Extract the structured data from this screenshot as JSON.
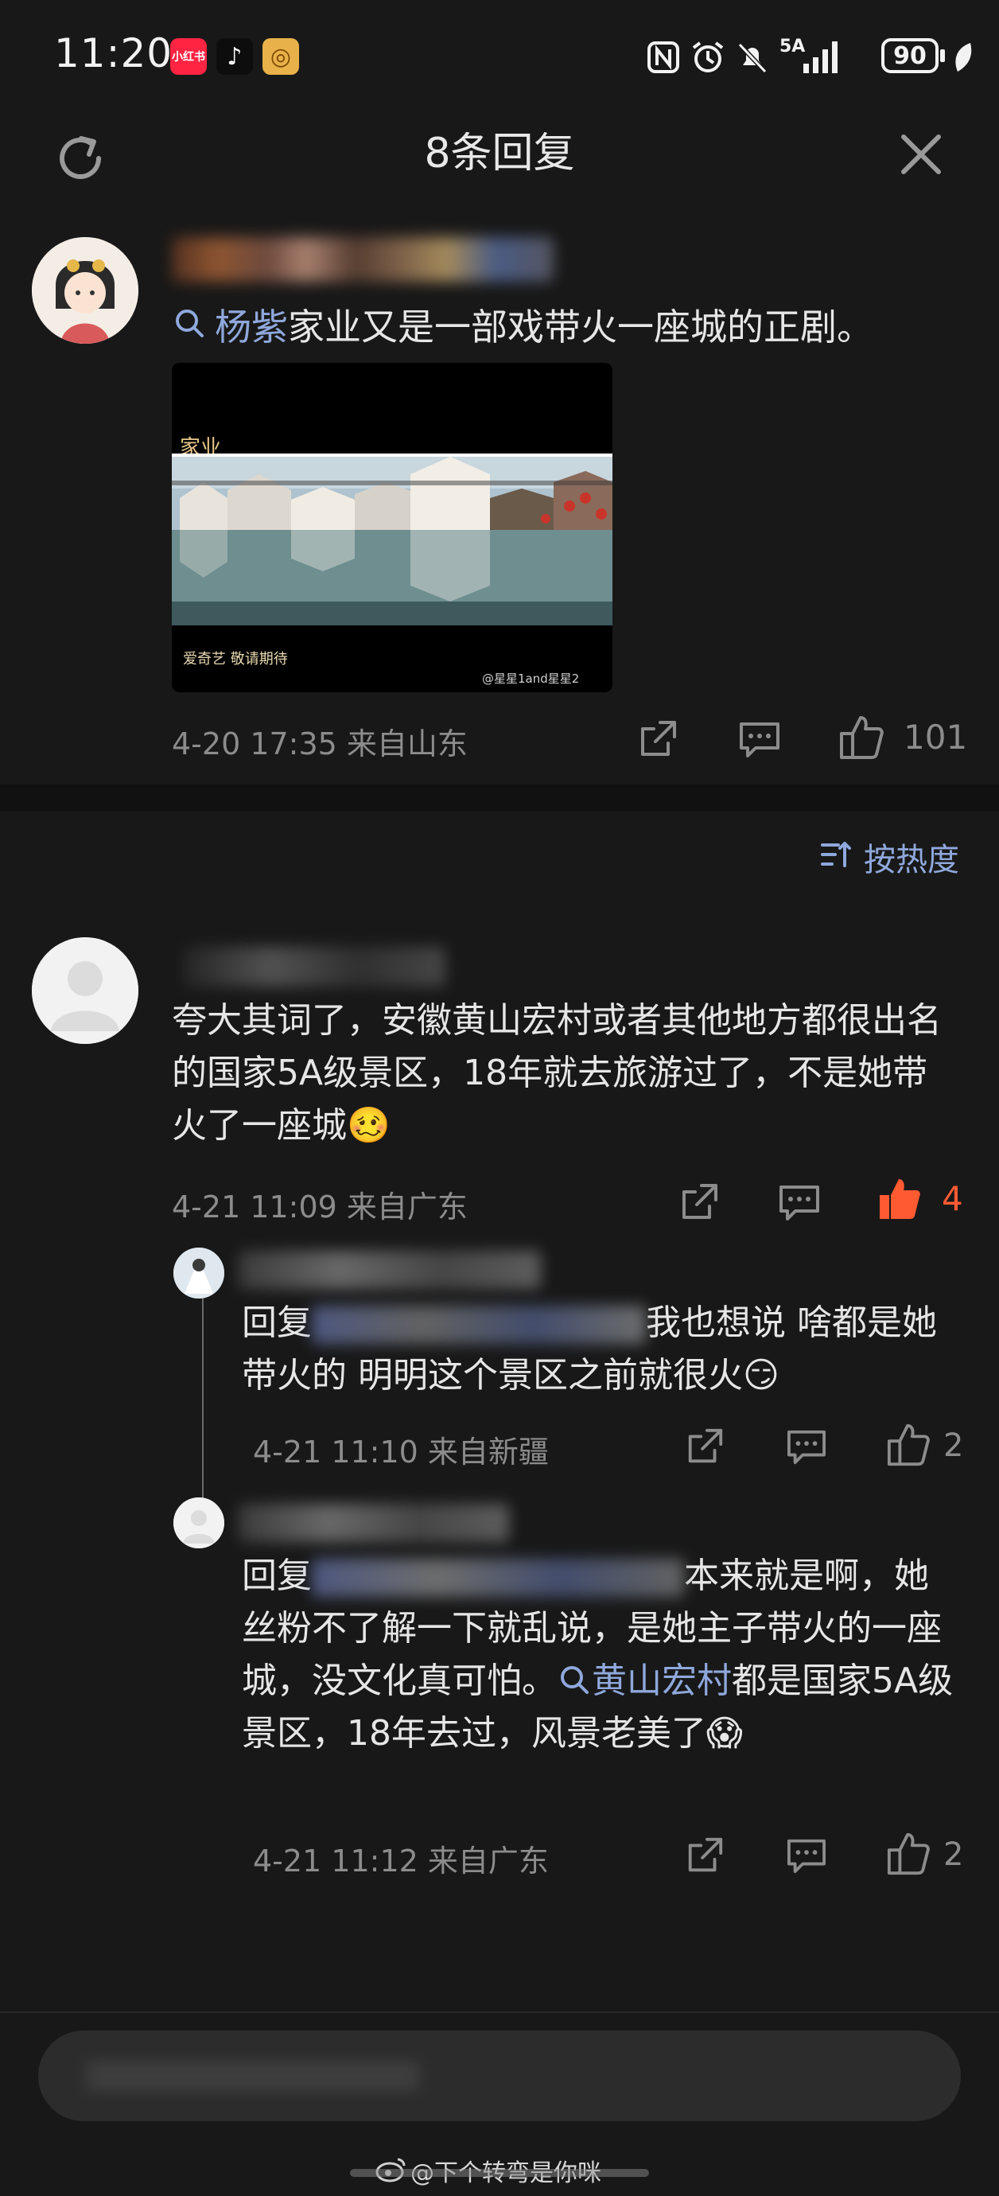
{
  "status_bar": {
    "time": "11:20",
    "apps": [
      {
        "name": "xiaohongshu",
        "label": "小红书",
        "color": "#ff2442"
      },
      {
        "name": "douyin",
        "label": "♪",
        "color": "#111111"
      },
      {
        "name": "app3",
        "label": "◎",
        "color": "#e9b14a"
      }
    ],
    "network": "5A",
    "battery": "90"
  },
  "header": {
    "title": "8条回复"
  },
  "post": {
    "topic_tag": "杨紫",
    "text": "家业又是一部戏带火一座城的正剧。",
    "video": {
      "overlay_title": "家业",
      "overlay_caption": "爱奇艺 敬请期待",
      "watermark": "@星星1and星星2"
    },
    "timestamp": "4-20 17:35 来自山东",
    "likes": "101"
  },
  "sort": {
    "label": "按热度"
  },
  "comment": {
    "text": "夸大其词了，安徽黄山宏村或者其他地方都很出名的国家5A级景区，18年就去旅游过了，不是她带火了一座城🥴",
    "timestamp": "4-21 11:09 来自广东",
    "likes": "4",
    "like_color": "#ff5a32"
  },
  "replies": [
    {
      "prefix": "回复",
      "text": "我也想说 啥都是她带火的 明明这个景区之前就很火😏",
      "timestamp": "4-21 11:10 来自新疆",
      "likes": "2"
    },
    {
      "prefix": "回复",
      "text_part1": "本来就是啊，她丝粉不了解一下就乱说，是她主子带火的一座城，没文化真可怕。",
      "tag": "黄山宏村",
      "text_part2": "都是国家5A级景区，18年去过，风景老美了😱",
      "timestamp": "4-21 11:12 来自广东",
      "likes": "2"
    }
  ],
  "footer": {
    "watermark": "@下个转弯是你咪"
  }
}
